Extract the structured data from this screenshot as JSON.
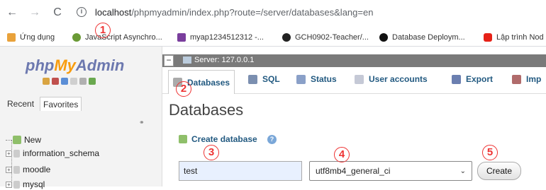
{
  "browser": {
    "back_icon": "←",
    "forward_icon": "→",
    "reload_icon": "C",
    "url_host": "localhost",
    "url_rest": "/phpmyadmin/index.php?route=/server/databases&lang=en"
  },
  "bookmarks": [
    {
      "label": "Ứng dụng",
      "color": "#e9a23b"
    },
    {
      "label": "JavaScript Asynchro...",
      "color": "#6a9a35"
    },
    {
      "label": "myap1234512312 -...",
      "color": "#7a3e9d"
    },
    {
      "label": "GCH0902-Teacher/...",
      "color": "#222222"
    },
    {
      "label": "Database Deploym...",
      "color": "#111111"
    },
    {
      "label": "Lập trình Nod",
      "color": "#e62117"
    }
  ],
  "sidebar": {
    "logo_php": "php",
    "logo_my": "My",
    "logo_admin": "Admin",
    "tab_recent": "Recent",
    "tab_favorites": "Favorites",
    "tree": [
      {
        "label": "New"
      },
      {
        "label": "information_schema"
      },
      {
        "label": "moodle"
      },
      {
        "label": "mysql"
      }
    ]
  },
  "server": {
    "label": "Server: 127.0.0.1"
  },
  "tabs": [
    {
      "label": "Databases",
      "color": "#aaaaaa"
    },
    {
      "label": "SQL",
      "color": "#7b8fb0"
    },
    {
      "label": "Status",
      "color": "#8aa0c8"
    },
    {
      "label": "User accounts",
      "color": "#c5c9d6"
    },
    {
      "label": "Export",
      "color": "#6b7fb0"
    },
    {
      "label": "Imp",
      "color": "#b06b6b"
    }
  ],
  "main": {
    "title": "Databases",
    "create_label": "Create database",
    "db_name_value": "test",
    "collation_value": "utf8mb4_general_ci",
    "create_button": "Create"
  },
  "markers": [
    "1",
    "2",
    "3",
    "4",
    "5"
  ]
}
